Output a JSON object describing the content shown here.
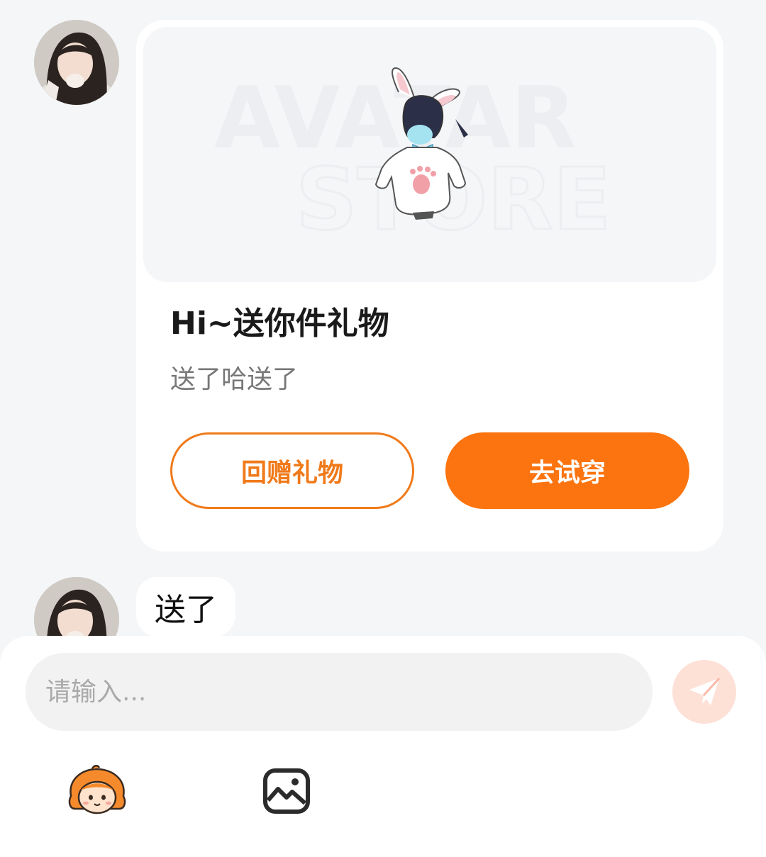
{
  "messages": {
    "gift_card": {
      "watermark_line1": "AVATAR",
      "watermark_line2": "STORE",
      "title": "Hi~送你件礼物",
      "subtitle": "送了哈送了",
      "return_gift_label": "回赠礼物",
      "try_on_label": "去试穿"
    },
    "text_message": {
      "text": "送了"
    }
  },
  "composer": {
    "placeholder": "请输入...",
    "send_icon": "paper-plane-icon",
    "emoji_icon": "mascot-emoji-icon",
    "image_icon": "image-icon"
  },
  "colors": {
    "accent": "#fc740f",
    "send_button_bg": "#fde1d7"
  }
}
